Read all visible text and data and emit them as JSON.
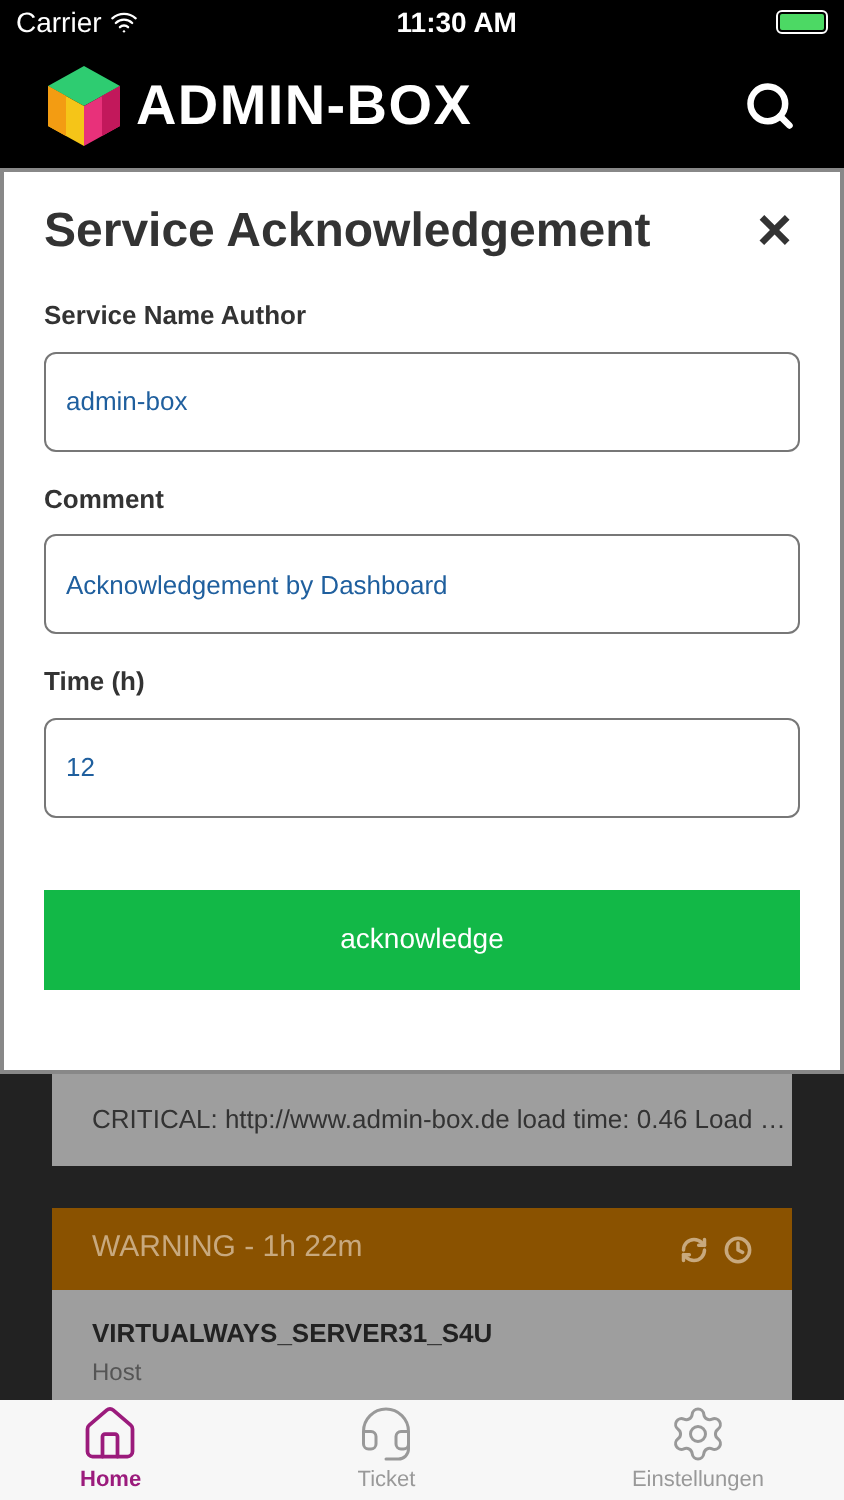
{
  "status_bar": {
    "carrier": "Carrier",
    "time": "11:30 AM"
  },
  "header": {
    "brand": "ADMIN-BOX"
  },
  "dialog": {
    "title": "Service Acknowledgement",
    "close": "×",
    "fields": [
      {
        "label": "Service Name Author",
        "value": "admin-box"
      },
      {
        "label": "Comment",
        "value": "Acknowledgement by Dashboard"
      },
      {
        "label": "Time (h)",
        "value": "12"
      }
    ],
    "submit": "acknowledge"
  },
  "alerts": [
    {
      "kind": "critical",
      "message": "CRITICAL: http://www.admin-box.de load time: 0.46 Load …"
    },
    {
      "kind": "warning",
      "status": "WARNING - 1h 22m",
      "host": "VIRTUALWAYS_SERVER31_S4U",
      "type": "Host"
    }
  ],
  "tabs": [
    {
      "label": "Home",
      "kind": "home",
      "selected": true
    },
    {
      "label": "Ticket",
      "kind": "agent",
      "selected": false
    },
    {
      "label": "Einstellungen",
      "kind": "gears",
      "selected": false
    }
  ]
}
